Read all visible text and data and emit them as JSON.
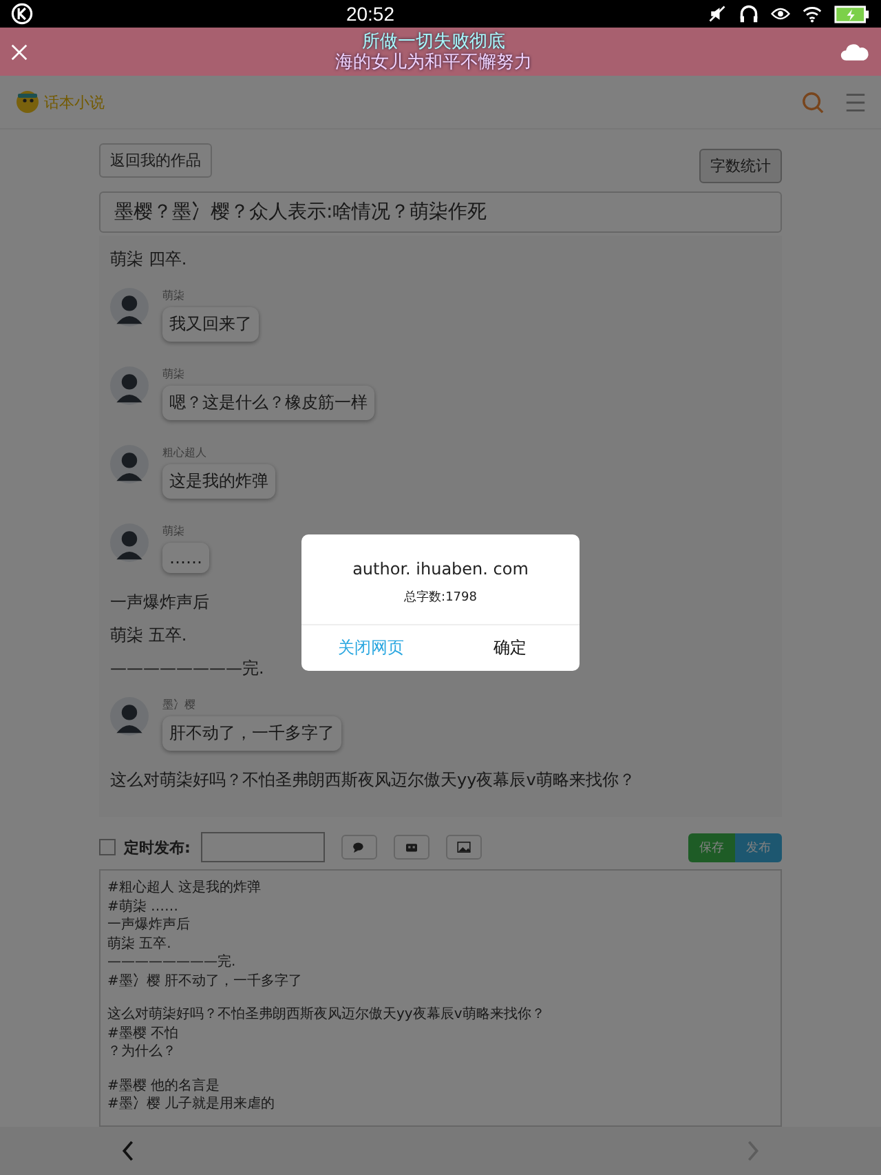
{
  "status_bar": {
    "time": "20:52"
  },
  "banner": {
    "lines": [
      "所做一切失败彻底",
      "海的女儿为和平不懈努力"
    ]
  },
  "header": {
    "logo": "话本小说"
  },
  "actions": {
    "back": "返回我的作品",
    "count": "字数统计"
  },
  "title_field": {
    "value": "墨樱？墨冫樱？众人表示:啥情况？萌柒作死"
  },
  "chat": [
    {
      "kind": "text",
      "text": "萌柒  四卒."
    },
    {
      "kind": "message",
      "name": "萌柒",
      "text": "我又回来了"
    },
    {
      "kind": "message",
      "name": "萌柒",
      "text": "嗯？这是什么？橡皮筋一样"
    },
    {
      "kind": "message",
      "name": "粗心超人",
      "text": "这是我的炸弹"
    },
    {
      "kind": "message",
      "name": "萌柒",
      "text": "……"
    },
    {
      "kind": "text",
      "text": "一声爆炸声后"
    },
    {
      "kind": "text",
      "text": "萌柒  五卒."
    },
    {
      "kind": "text",
      "text": "————————完."
    },
    {
      "kind": "message",
      "name": "墨冫樱",
      "text": "肝不动了，一千多字了"
    },
    {
      "kind": "text",
      "text": "这么对萌柒好吗？不怕圣弗朗西斯夜风迈尔傲天yy夜幕辰v萌略来找你？"
    }
  ],
  "toolbar": {
    "schedule_checked": false,
    "schedule_label": "定时发布:",
    "save": "保存",
    "publish": "发布"
  },
  "editor": {
    "blocks": [
      [
        "#粗心超人  这是我的炸弹",
        "#萌柒  ……",
        "一声爆炸声后",
        "萌柒  五卒.",
        "————————完.",
        "#墨冫樱  肝不动了，一千多字了"
      ],
      [
        "这么对萌柒好吗？不怕圣弗朗西斯夜风迈尔傲天yy夜幕辰v萌略来找你？",
        "#墨樱  不怕",
        "？为什么？"
      ],
      [
        "#墨樱  他的名言是",
        "#墨冫樱  儿子就是用来虐的"
      ]
    ]
  },
  "dialog": {
    "host": "author. ihuaben. com",
    "message": "总字数:1798",
    "cancel": "关闭网页",
    "confirm": "确定"
  },
  "nav": {
    "back_disabled": false,
    "forward_disabled": true
  }
}
